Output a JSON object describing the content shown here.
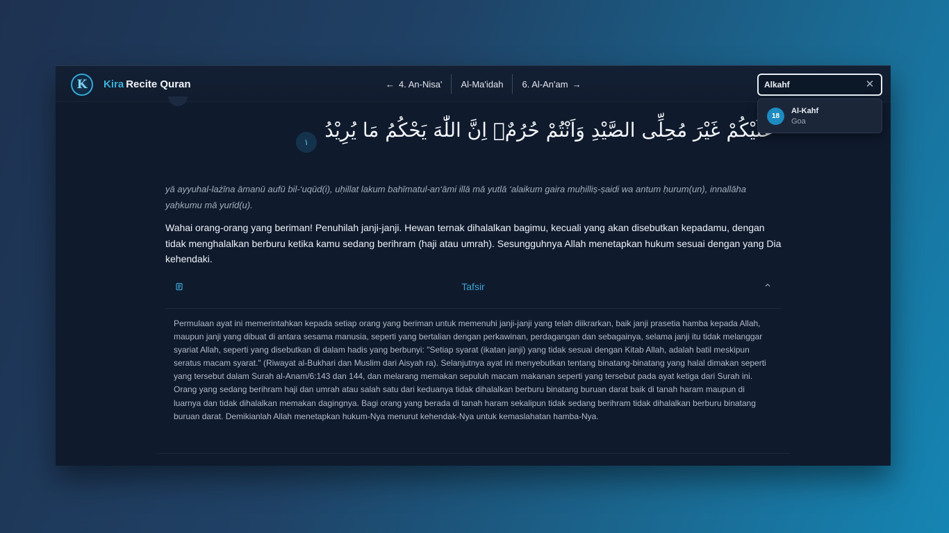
{
  "header": {
    "brand_prefix": "Kira",
    "brand_name": "Recite Quran",
    "logo_letter": "K"
  },
  "nav": {
    "prev_label": "4. An-Nisa'",
    "current_label": "Al-Ma'idah",
    "next_label": "6. Al-An'am"
  },
  "search": {
    "value": "Alkahf",
    "results": [
      {
        "number": "18",
        "name": "Al-Kahf",
        "subtitle": "Goa"
      }
    ]
  },
  "ayah": {
    "arabic": "عَلَيْكُمْ غَيْرَ مُحِلِّى الصَّيْدِ وَاَنْتُمْ حُرُمٌۗ اِنَّ اللّٰهَ يَحْكُمُ مَا يُرِيْدُ",
    "number_label": "١",
    "transliteration": "yā ayyuhal-lażīna āmanū aufū bil-‘uqūd(i), uḥillat lakum bahīmatul-an‘āmi illā mā yutlā ‘alaikum gaira muḥilliṣ-ṣaidi wa antum ḥurum(un), innallāha yaḥkumu mā yurīd(u).",
    "translation": "Wahai orang-orang yang beriman! Penuhilah janji-janji. Hewan ternak dihalalkan bagimu, kecuali yang akan disebutkan kepadamu, dengan tidak menghalalkan berburu ketika kamu sedang berihram (haji atau umrah). Sesungguhnya Allah menetapkan hukum sesuai dengan yang Dia kehendaki."
  },
  "tafsir": {
    "title": "Tafsir",
    "body": "Permulaan ayat ini memerintahkan kepada setiap orang yang beriman untuk memenuhi janji-janji yang telah diikrarkan, baik janji prasetia hamba kepada Allah, maupun janji yang dibuat di antara sesama manusia, seperti yang bertalian dengan perkawinan, perdagangan dan sebagainya, selama janji itu tidak melanggar syariat Allah, seperti yang disebutkan di dalam hadis yang berbunyi: \"Setiap syarat (ikatan janji) yang tidak sesuai dengan Kitab Allah, adalah batil meskipun seratus macam syarat.\" (Riwayat al-Bukhari dan Muslim dari Aisyah ra). Selanjutnya ayat ini menyebutkan tentang binatang-binatang yang halal dimakan seperti yang tersebut dalam Surah al-Anam/6:143 dan 144, dan melarang memakan sepuluh macam makanan seperti yang tersebut pada ayat ketiga dari Surah ini. Orang yang sedang berihram haji dan umrah atau salah satu dari keduanya tidak dihalalkan berburu binatang buruan darat baik di tanah haram maupun di luarnya dan tidak dihalalkan memakan dagingnya. Bagi orang yang berada di tanah haram sekalipun tidak sedang berihram tidak dihalalkan berburu binatang buruan darat. Demikianlah Allah menetapkan hukum-Nya menurut kehendak-Nya untuk kemaslahatan hamba-Nya."
  },
  "colors": {
    "accent": "#3aa6d4",
    "background": "#0f1a2d",
    "badge": "#1d8bc0"
  },
  "icons": [
    "logo-icon",
    "arrow-left-icon",
    "arrow-right-icon",
    "close-icon",
    "scroll-icon",
    "chevron-up-icon"
  ]
}
